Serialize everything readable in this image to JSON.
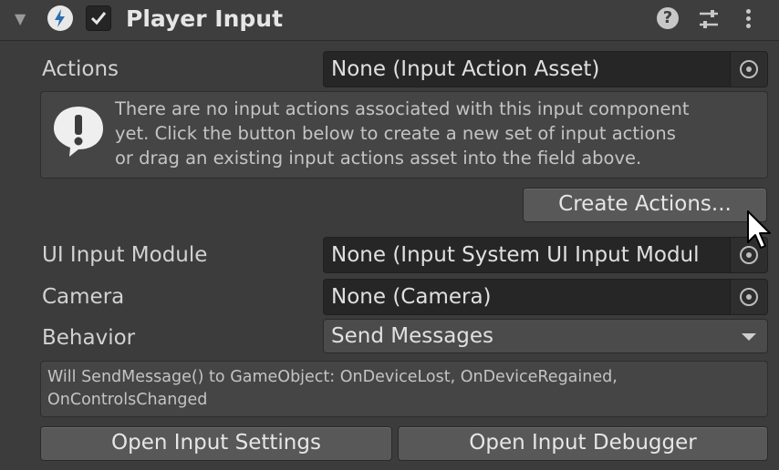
{
  "component": {
    "title": "Player Input",
    "enabled": true,
    "icon": "input-system-icon",
    "header_icons": [
      "help-icon",
      "presets-icon",
      "menu-icon"
    ]
  },
  "fields": {
    "actions": {
      "label": "Actions",
      "value": "None (Input Action Asset)"
    },
    "ui_input_module": {
      "label": "UI Input Module",
      "value": "None (Input System UI Input Modul"
    },
    "camera": {
      "label": "Camera",
      "value": "None (Camera)"
    },
    "behavior": {
      "label": "Behavior",
      "value": "Send Messages"
    }
  },
  "help_box": {
    "icon": "warning-icon",
    "lines": [
      "There are no input actions associated with this input component",
      "yet. Click the button below to create a new set of input actions",
      "or drag an existing input actions asset into the field above."
    ]
  },
  "buttons": {
    "create_actions": "Create Actions...",
    "open_settings": "Open Input Settings",
    "open_debugger": "Open Input Debugger"
  },
  "info_box": {
    "lines": [
      "Will SendMessage() to GameObject: OnDeviceLost, OnDeviceRegained,",
      "OnControlsChanged"
    ]
  },
  "colors": {
    "background": "#3c3c3c",
    "field": "#262626",
    "button": "#585858",
    "text": "#d6d6d6"
  }
}
